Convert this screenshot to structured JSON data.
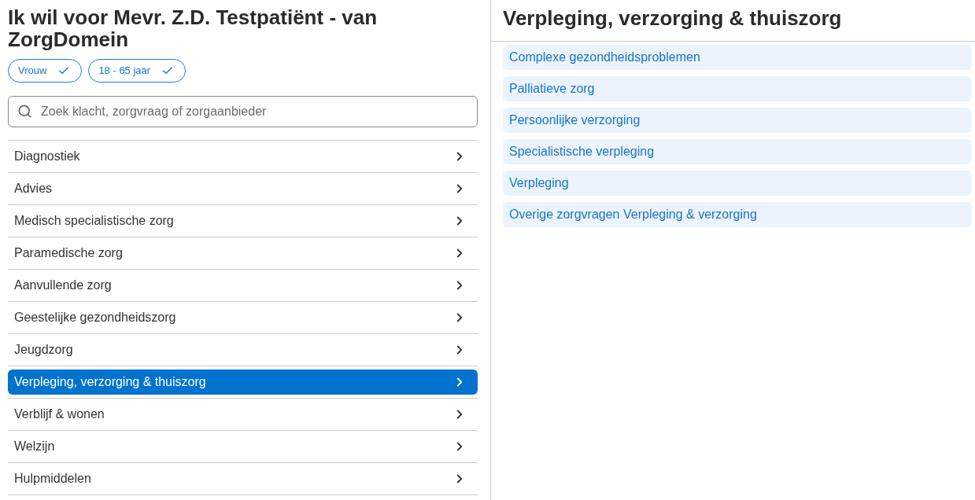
{
  "left_panel": {
    "title": "Ik wil voor Mevr. Z.D. Testpatiënt - van ZorgDomein",
    "filters": [
      {
        "label": "Vrouw",
        "checked": true
      },
      {
        "label": "18 - 65 jaar",
        "checked": true
      }
    ],
    "search": {
      "placeholder": "Zoek klacht, zorgvraag of zorgaanbieder"
    },
    "categories": [
      {
        "label": "Diagnostiek",
        "selected": false
      },
      {
        "label": "Advies",
        "selected": false
      },
      {
        "label": "Medisch specialistische zorg",
        "selected": false
      },
      {
        "label": "Paramedische zorg",
        "selected": false
      },
      {
        "label": "Aanvullende zorg",
        "selected": false
      },
      {
        "label": "Geestelijke gezondheidszorg",
        "selected": false
      },
      {
        "label": "Jeugdzorg",
        "selected": false
      },
      {
        "label": "Verpleging, verzorging & thuiszorg",
        "selected": true
      },
      {
        "label": "Verblijf & wonen",
        "selected": false
      },
      {
        "label": "Welzijn",
        "selected": false
      },
      {
        "label": "Hulpmiddelen",
        "selected": false
      }
    ]
  },
  "right_panel": {
    "title": "Verpleging, verzorging & thuiszorg",
    "subcategories": [
      "Complexe gezondheidsproblemen",
      "Palliatieve zorg",
      "Persoonlijke verzorging",
      "Specialistische verpleging",
      "Verpleging",
      "Overige zorgvragen Verpleging & verzorging"
    ]
  }
}
